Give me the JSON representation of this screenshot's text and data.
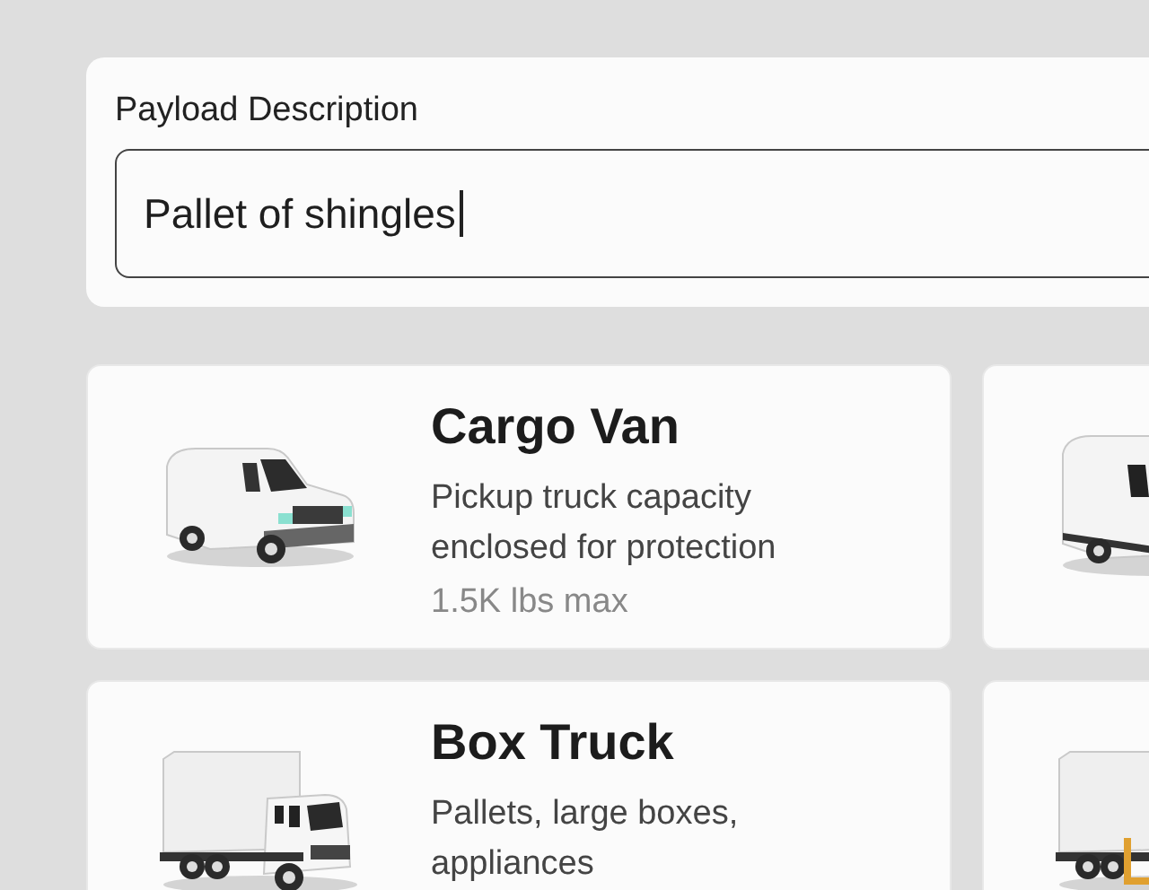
{
  "payload": {
    "label": "Payload Description",
    "value": "Pallet of shingles"
  },
  "vehicles": [
    {
      "kind": "cargo-van",
      "title": "Cargo Van",
      "description": "Pickup truck capacity enclosed for protection",
      "capacity": "1.5K lbs max"
    },
    {
      "kind": "high-roof-van"
    },
    {
      "kind": "box-truck",
      "title": "Box Truck",
      "description": "Pallets, large boxes, appliances"
    },
    {
      "kind": "liftgate-truck"
    }
  ]
}
